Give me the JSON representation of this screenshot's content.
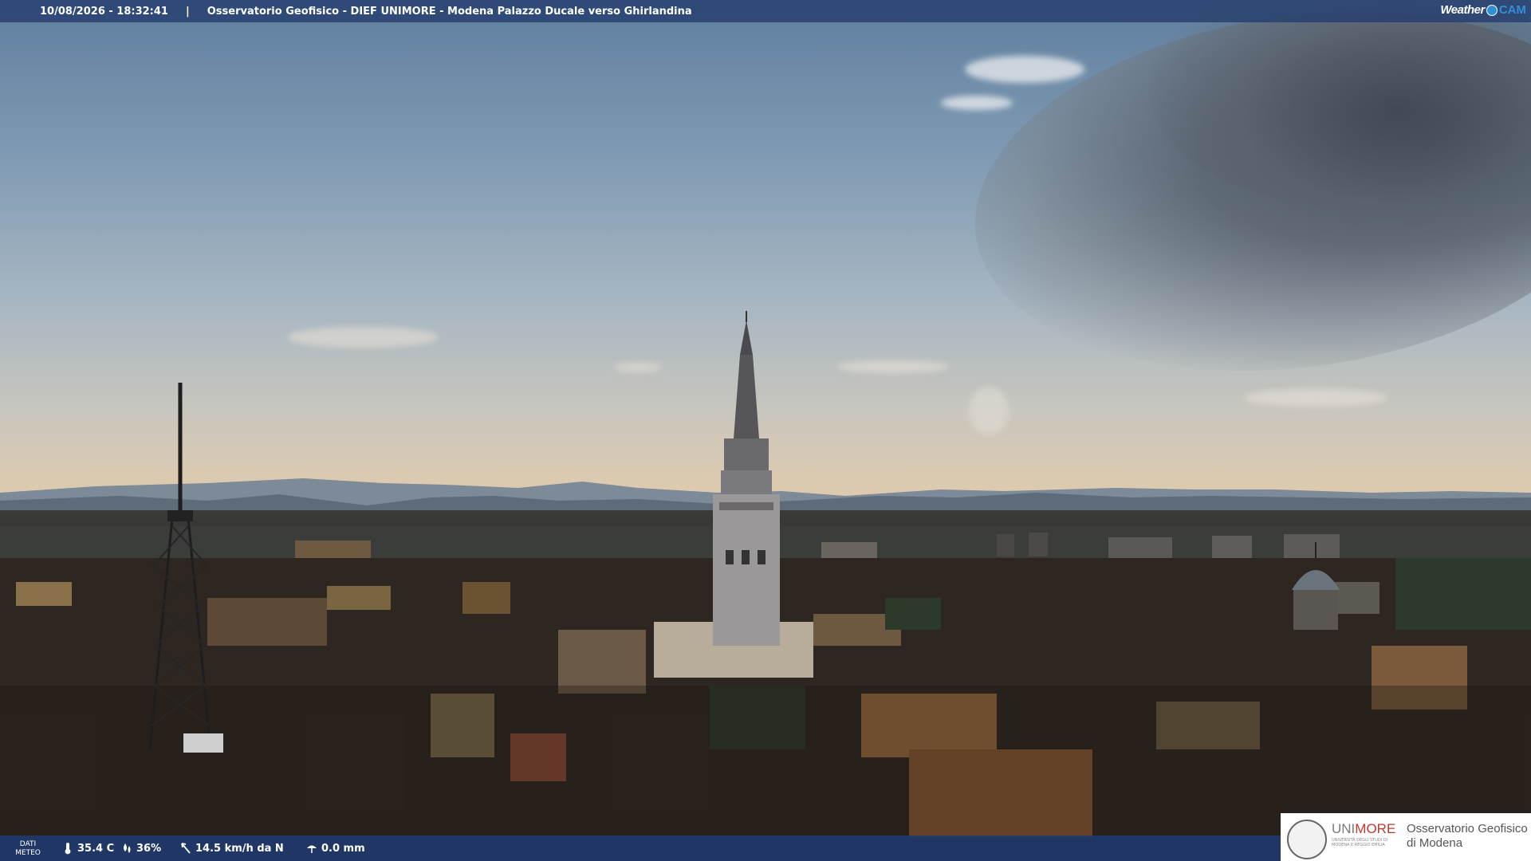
{
  "header": {
    "timestamp": "10/08/2026 - 18:32:41",
    "separator": "|",
    "camera_title": "Osservatorio Geofisico - DIEF UNIMORE - Modena Palazzo Ducale verso Ghirlandina",
    "brand_weather": "Weather",
    "brand_cam": "CAM"
  },
  "meteo": {
    "label_line1": "DATI",
    "label_line2": "METEO",
    "temperature": "35.4 C",
    "humidity": "36%",
    "wind": "14.5 km/h da N",
    "rain": "0.0 mm"
  },
  "logo": {
    "uni_part1": "UNI",
    "uni_part2": "MORE",
    "uni_small": "UNIVERSITÀ DEGLI STUDI DI MODENA E REGGIO EMILIA",
    "org_line1": "Osservatorio Geofisico",
    "org_line2": "di Modena"
  },
  "colors": {
    "bar_blue": "#263e6e",
    "brand_blue": "#2f90d8",
    "unimore_red": "#c0392b"
  }
}
